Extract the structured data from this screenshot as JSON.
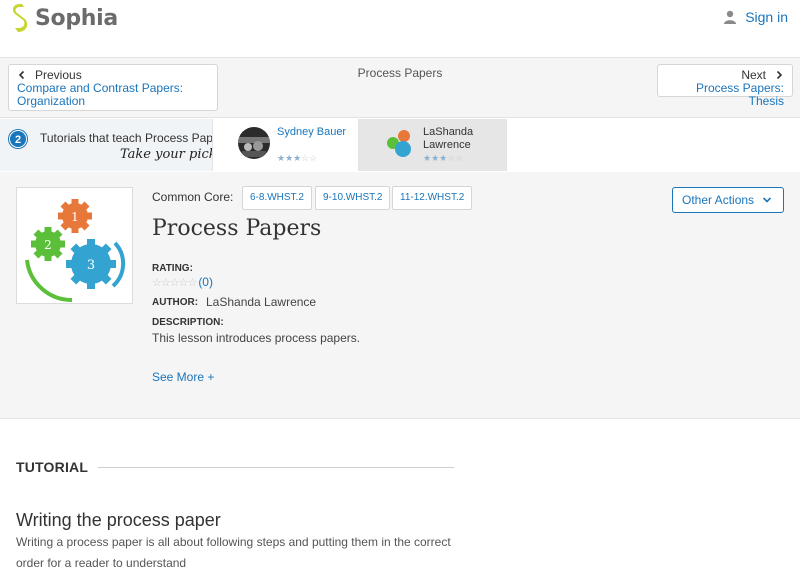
{
  "header": {
    "logo_text": "Sophia",
    "sign_in_label": "Sign in",
    "brand_color": "#c6d62f",
    "link_color": "#1a75bb"
  },
  "nav": {
    "previous_label": "Previous",
    "previous_link": "Compare and Contrast Papers: Organization",
    "current_title": "Process Papers",
    "next_label": "Next",
    "next_link": "Process Papers: Thesis"
  },
  "tutorials_strip": {
    "number": "2",
    "intro_text": "Tutorials that teach Process Papers",
    "pick_text": "Take your pick:",
    "cards": [
      {
        "name": "Sydney Bauer",
        "rating": 3,
        "max": 5
      },
      {
        "name": "LaShanda Lawrence",
        "rating": 3,
        "max": 5
      }
    ]
  },
  "lesson": {
    "common_core_label": "Common Core:",
    "standards": [
      "6-8.WHST.2",
      "9-10.WHST.2",
      "11-12.WHST.2"
    ],
    "title": "Process Papers",
    "rating_label": "RATING:",
    "rating_count": "(0)",
    "author_label": "AUTHOR:",
    "author_name": "LaShanda Lawrence",
    "description_label": "DESCRIPTION:",
    "description": "This lesson introduces process papers.",
    "see_more": "See More +",
    "other_actions": "Other Actions",
    "thumbnail_gears": [
      "1",
      "2",
      "3"
    ]
  },
  "tutorial": {
    "heading": "TUTORIAL",
    "title": "Writing the process paper",
    "text": "Writing a process paper is all about following steps and putting them in the correct order for a reader to understand"
  }
}
